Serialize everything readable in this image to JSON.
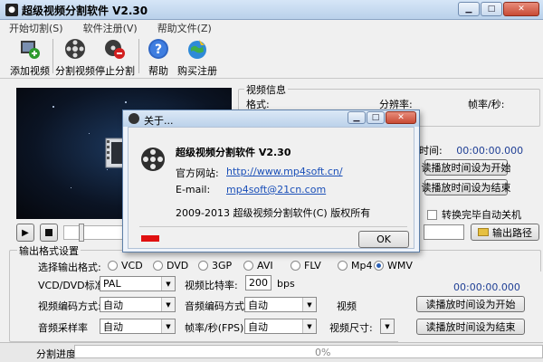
{
  "window": {
    "title": "超级视频分割软件 V2.30"
  },
  "menu": [
    "开始切割(S)",
    "软件注册(V)",
    "帮助文件(Z)"
  ],
  "toolbar": {
    "add_video": "添加视频",
    "split_video": "分割视频",
    "stop_split": "停止分割",
    "help": "帮助",
    "buy": "购买注册"
  },
  "video_info": {
    "group_title": "视频信息",
    "format_label": "格式:",
    "resolution_label": "分辨率:",
    "framerate_label": "帧率/秒:"
  },
  "time_panel": {
    "time_label": "时间:",
    "time_value_1": "00:00:00.000",
    "set_start_button": "读播放时间设为开始",
    "set_end_button": "读播放时间设为结束",
    "auto_shutdown_label": "转换完毕自动关机",
    "output_path_button": "输出路径"
  },
  "output": {
    "group_title": "输出格式设置",
    "format_label": "选择输出格式:",
    "formats": [
      "VCD",
      "DVD",
      "3GP",
      "AVI",
      "FLV",
      "Mp4",
      "WMV"
    ],
    "selected_format": "WMV",
    "vcd_std_label": "VCD/DVD标准:",
    "vcd_std_value": "PAL",
    "bitrate_label": "视频比特率:",
    "bitrate_value": "200",
    "bitrate_unit": "bps",
    "video_codec_label": "视频编码方式:",
    "video_codec_value": "自动",
    "audio_codec_label": "音频编码方式:",
    "audio_codec_value": "自动",
    "video_trunc_label": "视频",
    "audio_rate_label": "音频采样率",
    "audio_rate_value": "自动",
    "fps_label": "帧率/秒(FPS)",
    "fps_value": "自动",
    "video_size_label": "视频尺寸:",
    "time_value_2": "00:00:00.000",
    "set_start_button_2": "读播放时间设为开始",
    "set_end_button_2": "读播放时间设为结束"
  },
  "status": {
    "label": "分割进度",
    "percent": "0%",
    "progress_fraction": 0
  },
  "about": {
    "title": "关于...",
    "app_name": "超级视频分割软件 V2.30",
    "website_label": "官方网站:",
    "website_url": "http://www.mp4soft.cn/",
    "email_label": "E-mail:",
    "email_value": "mp4soft@21cn.com",
    "copyright": "2009-2013 超级视频分割软件(C) 版权所有",
    "ok_button": "OK"
  },
  "colors": {
    "accent": "#2a5fb5",
    "link": "#1a4fb8",
    "toolbar_bg": "#f0f0f0",
    "badge_red": "#e01010"
  }
}
